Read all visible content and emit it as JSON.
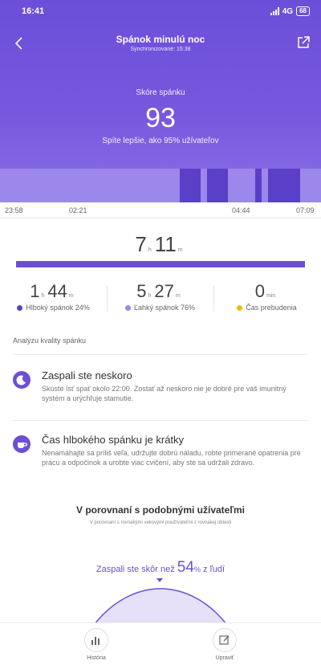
{
  "status_bar": {
    "time": "16:41",
    "network": "4G",
    "battery": "68"
  },
  "header": {
    "title": "Spánok minulú noc",
    "subtitle": "Synchronizované: 15:38"
  },
  "score": {
    "label": "Skóre spánku",
    "value": "93",
    "description": "Spíte lepšie, ako 95% užívateľov"
  },
  "timeline": {
    "t1": "23:58",
    "t2": "02:21",
    "t3": "04:44",
    "t4": "07:09"
  },
  "sleep_segments": [
    {
      "type": "light",
      "start": 0.0,
      "end": 0.56
    },
    {
      "type": "deep",
      "start": 0.56,
      "end": 0.625
    },
    {
      "type": "light",
      "start": 0.625,
      "end": 0.645
    },
    {
      "type": "deep",
      "start": 0.645,
      "end": 0.71
    },
    {
      "type": "light",
      "start": 0.71,
      "end": 0.795
    },
    {
      "type": "deep",
      "start": 0.795,
      "end": 0.815
    },
    {
      "type": "light",
      "start": 0.815,
      "end": 0.835
    },
    {
      "type": "deep",
      "start": 0.835,
      "end": 0.935
    },
    {
      "type": "light",
      "start": 0.935,
      "end": 1.0
    }
  ],
  "colors": {
    "deep": "#5a3fc8",
    "light": "#9c87ea",
    "awake": "#f5b800",
    "accent": "#6c4fd6"
  },
  "total": {
    "hours": "7",
    "hours_unit": "h",
    "minutes": "11",
    "minutes_unit": "m"
  },
  "stats": {
    "deep": {
      "hours": "1",
      "h_unit": "h",
      "minutes": "44",
      "m_unit": "m",
      "label": "Hlboký spánok 24%"
    },
    "light": {
      "hours": "5",
      "h_unit": "h",
      "minutes": "27",
      "m_unit": "m",
      "label": "Ľahký spánok 76%"
    },
    "awake": {
      "value": "0",
      "unit": "min",
      "label": "Čas prebudenia"
    }
  },
  "analysis": {
    "title": "Analýzu kvality spánku",
    "tips": [
      {
        "icon": "moon-icon",
        "title": "Zaspali ste neskoro",
        "text": "Skúste ísť spať okolo 22:00. Zostať až neskoro nie je dobré pre váš imunitný systém a urýchľuje stamutie."
      },
      {
        "icon": "cup-icon",
        "title": "Čas hlbokého spánku je krátky",
        "text": "Nenamáhajte sa príliš veľa, udržujte dobrú náladu, robte primerané opatrenia pre prácu a odpočinok a urobte viac cvičení, aby ste sa udržali zdravo."
      }
    ]
  },
  "comparison": {
    "title": "V porovnaní s podobnými užívateľmi",
    "subtitle": "V porovnaní s rovnakými vekovými používateľmi z rovnakej oblasti",
    "prefix": "Zaspali ste skôr než",
    "percent": "54",
    "percent_sign": "%",
    "suffix": "z ľudí"
  },
  "bottom_nav": {
    "history": "História",
    "edit": "Upraviť"
  }
}
